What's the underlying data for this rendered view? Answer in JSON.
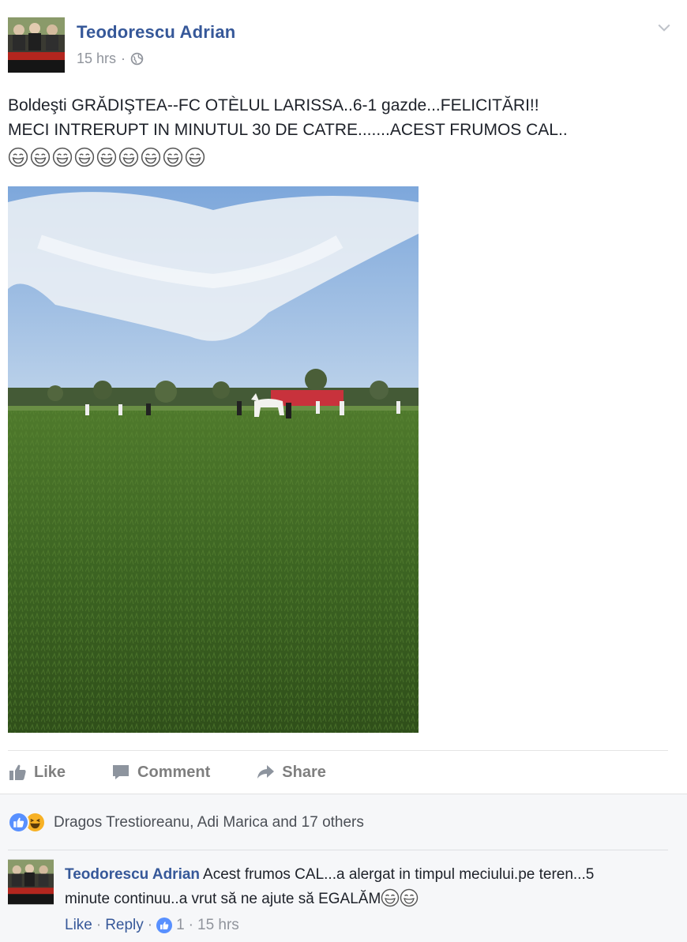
{
  "post": {
    "author": "Teodorescu Adrian",
    "time": "15 hrs",
    "dot": "·",
    "text_line1": "Boldeşti GRĂDIŞTEA--FC OTÈLUL LARISSA..6-1 gazde...FELICITĂRI!!",
    "text_line2": "MECI INTRERUPT IN MINUTUL 30 DE CATRE.......ACEST FRUMOS CAL..",
    "emoji_count": 9,
    "privacy_icon": "globe-icon",
    "menu_icon": "chevron-down-icon"
  },
  "actions": {
    "like": "Like",
    "comment": "Comment",
    "share": "Share"
  },
  "feedback": {
    "reactors": "Dragos Trestioreanu, Adi Marica and 17 others",
    "reactions": [
      "like-reaction-icon",
      "haha-reaction-icon"
    ]
  },
  "comment": {
    "author": "Teodorescu Adrian",
    "text": "Acest frumos CAL...a alergat in timpul meciului.pe teren...5 minute continuu..a vrut să ne ajute să EGALĂM",
    "like": "Like",
    "reply": "Reply",
    "dot": "·",
    "like_count": "1",
    "time": "15 hrs"
  },
  "colors": {
    "link": "#365899",
    "like_blue": "#5890ff",
    "meta_gray": "#90949c",
    "feedback_bg": "#f6f7f9"
  }
}
